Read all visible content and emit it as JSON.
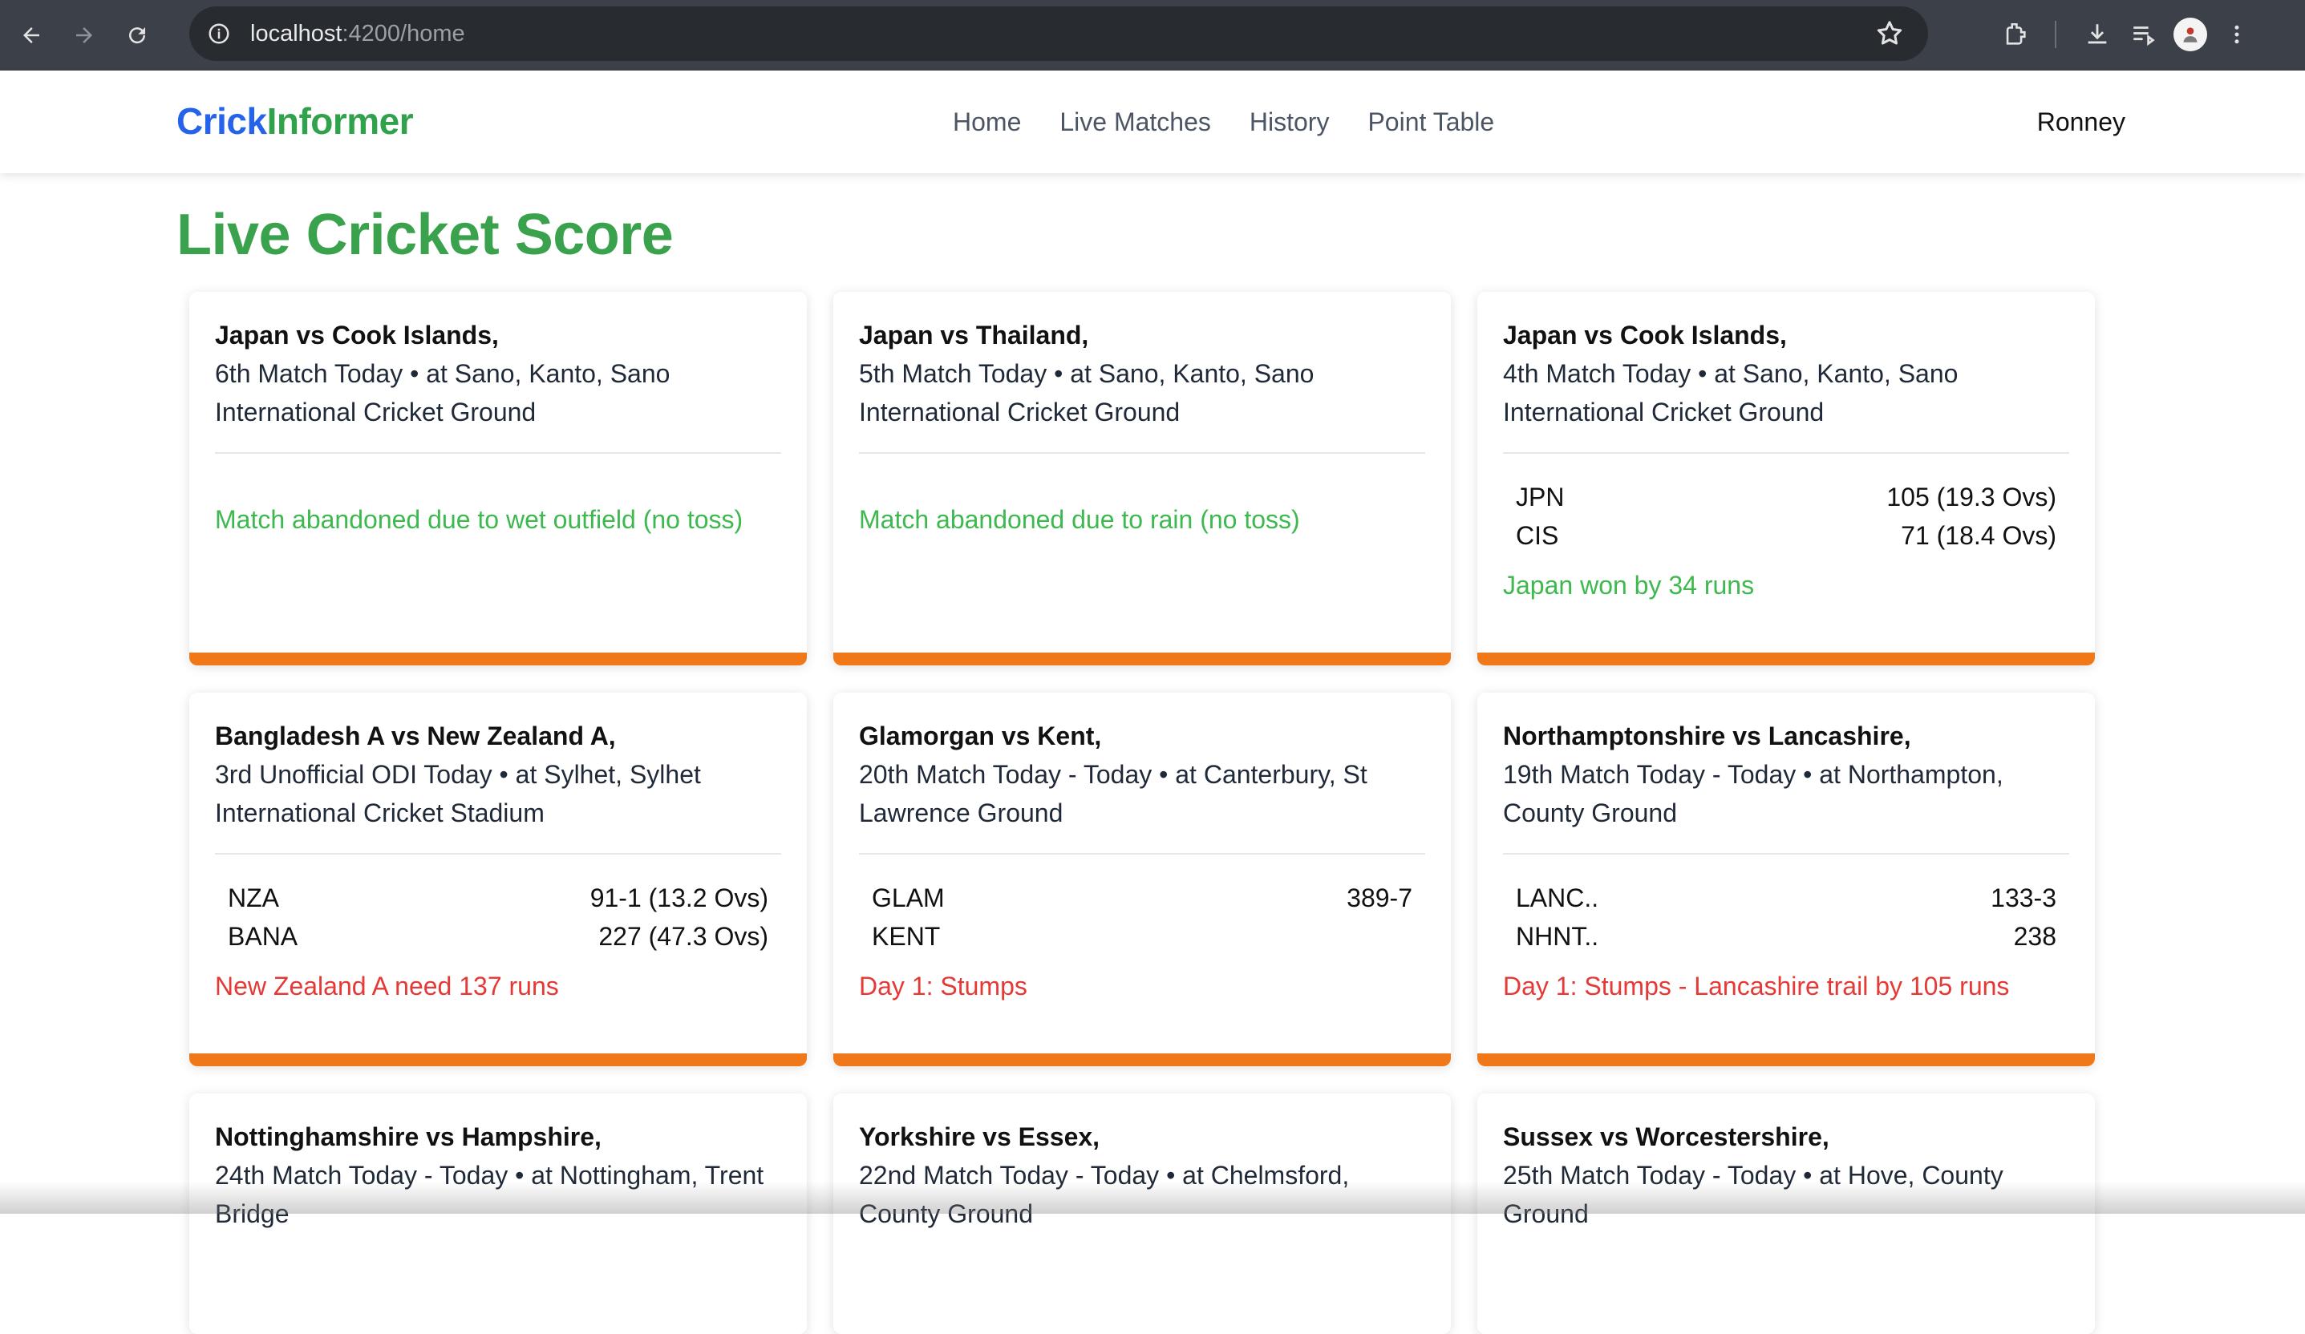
{
  "browser": {
    "url_host": "localhost",
    "url_path": ":4200/home"
  },
  "header": {
    "brand_part1": "Crick",
    "brand_part2": "Informer",
    "nav": [
      "Home",
      "Live Matches",
      "History",
      "Point Table"
    ],
    "user": "Ronney"
  },
  "page_title": "Live Cricket Score",
  "matches": [
    {
      "title": "Japan vs Cook Islands,",
      "desc": "6th Match Today • at Sano, Kanto, Sano International Cricket Ground",
      "teams": [],
      "status": "Match abandoned due to wet outfield (no toss)",
      "status_color": "green"
    },
    {
      "title": "Japan vs Thailand,",
      "desc": "5th Match Today • at Sano, Kanto, Sano International Cricket Ground",
      "teams": [],
      "status": "Match abandoned due to rain (no toss)",
      "status_color": "green"
    },
    {
      "title": "Japan vs Cook Islands,",
      "desc": "4th Match Today • at Sano, Kanto, Sano International Cricket Ground",
      "teams": [
        {
          "name": "JPN",
          "score": "105 (19.3 Ovs)"
        },
        {
          "name": "CIS",
          "score": "71 (18.4 Ovs)"
        }
      ],
      "status": "Japan won by 34 runs",
      "status_color": "green"
    },
    {
      "title": "Bangladesh A vs New Zealand A,",
      "desc": "3rd Unofficial ODI Today • at Sylhet, Sylhet International Cricket Stadium",
      "teams": [
        {
          "name": "NZA",
          "score": "91-1 (13.2 Ovs)"
        },
        {
          "name": "BANA",
          "score": "227 (47.3 Ovs)"
        }
      ],
      "status": "New Zealand A need 137 runs",
      "status_color": "red"
    },
    {
      "title": "Glamorgan vs Kent,",
      "desc": "20th Match Today - Today • at Canterbury, St Lawrence Ground",
      "teams": [
        {
          "name": "GLAM",
          "score": "389-7"
        },
        {
          "name": "KENT",
          "score": ""
        }
      ],
      "status": "Day 1: Stumps",
      "status_color": "red"
    },
    {
      "title": "Northamptonshire vs Lancashire,",
      "desc": "19th Match Today - Today • at Northampton, County Ground",
      "teams": [
        {
          "name": "LANC..",
          "score": "133-3"
        },
        {
          "name": "NHNT..",
          "score": "238"
        }
      ],
      "status": "Day 1: Stumps - Lancashire trail by 105 runs",
      "status_color": "red"
    },
    {
      "title": "Nottinghamshire vs Hampshire,",
      "desc": "24th Match Today - Today • at Nottingham, Trent Bridge",
      "teams": [],
      "status": "",
      "status_color": "red"
    },
    {
      "title": "Yorkshire vs Essex,",
      "desc": "22nd Match Today - Today • at Chelmsford, County Ground",
      "teams": [],
      "status": "",
      "status_color": "red"
    },
    {
      "title": "Sussex vs Worcestershire,",
      "desc": "25th Match Today - Today • at Hove, County Ground",
      "teams": [],
      "status": "",
      "status_color": "red"
    }
  ]
}
